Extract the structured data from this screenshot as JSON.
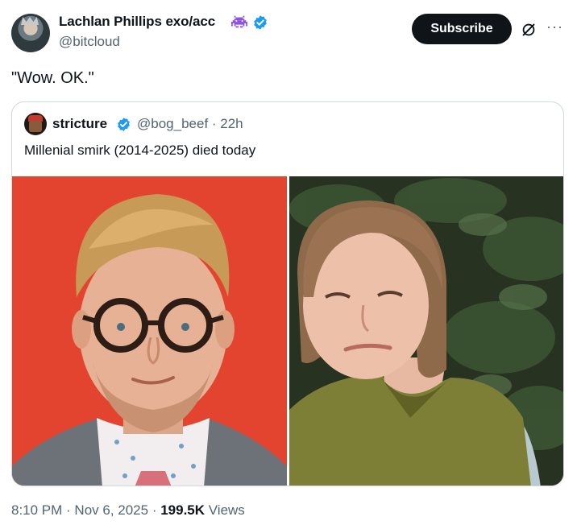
{
  "author": {
    "name": "Lachlan Phillips exo/acc",
    "handle": "@bitcloud",
    "badge_icon": "alien-monster-icon",
    "verified_icon": "verified-badge-icon"
  },
  "actions": {
    "subscribe_label": "Subscribe",
    "grok_icon": "grok-icon",
    "more_label": "···"
  },
  "tweet": {
    "text": "\"Wow. OK.\""
  },
  "quote": {
    "name": "stricture",
    "handle_time": "@bog_beef · 22h",
    "text": "Millenial smirk (2014-2025) died today",
    "images": [
      "man-with-glasses-red-background",
      "woman-in-green-sweater-garden"
    ]
  },
  "footer": {
    "timestamp": "8:10 PM · Nov 6, 2025 · ",
    "views_count": "199.5K",
    "views_label": " Views"
  },
  "colors": {
    "accent": "#1d9bf0",
    "text": "#0f1419",
    "muted": "#536471",
    "border": "#cfd9de"
  }
}
